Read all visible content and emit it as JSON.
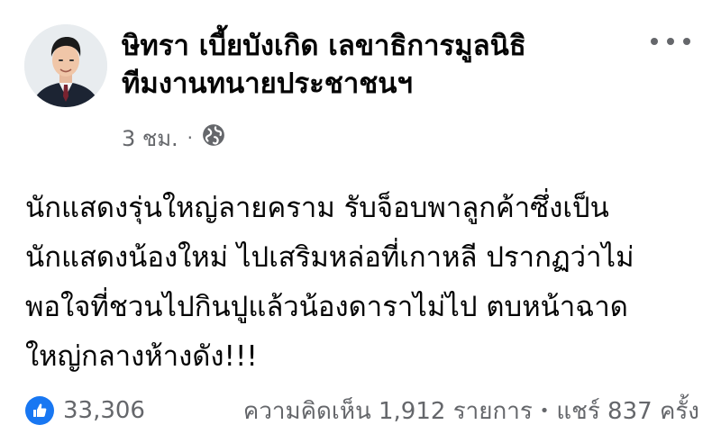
{
  "post": {
    "author_line1": "ษิทรา เบี้ยบังเกิด เลขาธิการมูลนิธิ",
    "author_line2": "ทีมงานทนายประชาชนฯ",
    "time": "3 ชม.",
    "separator": "·",
    "privacy_icon": "globe-icon",
    "more_icon": "more-horizontal-icon",
    "content_lines": [
      "นักแสดงรุ่นใหญ่ลายคราม รับจ็อบพาลูกค้าซึ่งเป็น",
      "นักแสดงน้องใหม่ ไปเสริมหล่อที่เกาหลี ปรากฏว่าไม่",
      "พอใจที่ชวนไปกินปูแล้วน้องดาราไม่ไป ตบหน้าฉาด",
      "ใหญ่กลางห้างดัง!!!"
    ]
  },
  "footer": {
    "reaction_icon": "like-icon",
    "reaction_count": "33,306",
    "comments": "ความคิดเห็น 1,912 รายการ",
    "dot": "•",
    "shares": "แชร์ 837 ครั้ง"
  },
  "colors": {
    "text_primary": "#050505",
    "text_secondary": "#65676b",
    "like_blue": "#1877f2"
  }
}
